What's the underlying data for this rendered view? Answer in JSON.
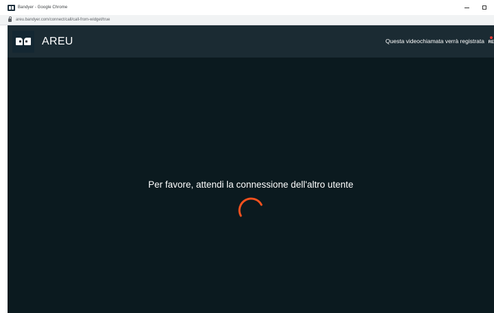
{
  "window": {
    "title": "Bandyer - Google Chrome"
  },
  "browser": {
    "url": "areu.bandyer.com/connect/call/call-from-widget/true"
  },
  "header": {
    "brand": "AREU",
    "recording_notice": "Questa videochiamata verrà registrata",
    "recording_badge": "RE"
  },
  "main": {
    "waiting_message": "Per favore, attendi la connessione dell'altro utente"
  },
  "colors": {
    "header_bg": "#1b2b33",
    "stage_bg": "#0b1a1f",
    "spinner": "#f4511e",
    "recording_dot": "#e53935"
  },
  "icons": {
    "favicon": "bandyer-logo-icon",
    "lock": "lock-icon",
    "spinner": "loading-spinner-icon"
  }
}
